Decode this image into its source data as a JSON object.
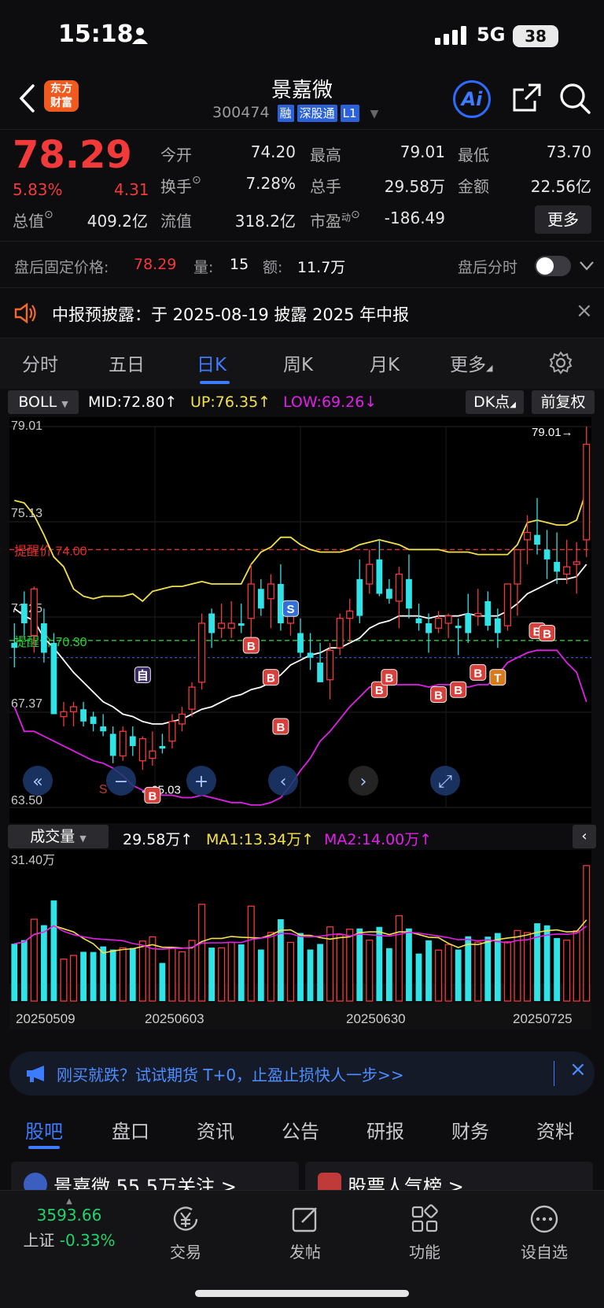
{
  "status": {
    "time": "15:18",
    "network": "5G",
    "battery": "38"
  },
  "header": {
    "logo_text": "东方\n财富",
    "title": "景嘉微",
    "code": "300474",
    "tags": [
      "融",
      "深股通",
      "L1"
    ],
    "ai_label": "Ai"
  },
  "quote": {
    "price": "78.29",
    "change_pct": "5.83%",
    "change": "4.31",
    "fields": [
      {
        "label": "今开",
        "value": "74.20",
        "color": "red"
      },
      {
        "label": "最高",
        "value": "79.01",
        "color": "red"
      },
      {
        "label": "最低",
        "value": "73.70",
        "color": "green"
      },
      {
        "label": "换手",
        "value": "7.28%",
        "color": "white"
      },
      {
        "label": "总手",
        "value": "29.58万",
        "color": "white"
      },
      {
        "label": "金额",
        "value": "22.56亿",
        "color": "white"
      },
      {
        "label": "总值",
        "value": "409.2亿",
        "color": "white"
      },
      {
        "label": "流值",
        "value": "318.2亿",
        "color": "white"
      },
      {
        "label": "市盈",
        "value": "-186.49",
        "color": "white"
      }
    ],
    "pe_superscript": "动",
    "more_label": "更多"
  },
  "afterhours": {
    "price_label": "盘后固定价格:",
    "price": "78.29",
    "vol_label": "量:",
    "vol": "15",
    "amt_label": "额:",
    "amt": "11.7万",
    "toggle_label": "盘后分时"
  },
  "notice": {
    "text": "中报预披露：于 2025-08-19 披露 2025 年中报"
  },
  "chart_tabs": [
    "分时",
    "五日",
    "日K",
    "周K",
    "月K",
    "更多"
  ],
  "indicator": {
    "name": "BOLL",
    "mid": "MID:72.80",
    "up": "UP:76.35",
    "low": "LOW:69.26",
    "dk_label": "DK点",
    "adj_label": "前复权"
  },
  "kchart_labels": {
    "axis": [
      "79.01",
      "75.13",
      "71.25",
      "67.37",
      "63.50"
    ],
    "alert_high": "提醒价 74.00",
    "alert_low": "提醒价 70.30",
    "max_label": "79.01→",
    "min_label": "←65.03",
    "marker_self": "自",
    "marker_s": "S",
    "marker_b": "B",
    "marker_t": "T"
  },
  "chart_data": {
    "type": "candlestick",
    "ylim": [
      63.5,
      79.01
    ],
    "candles": [
      [
        70.2,
        71.0,
        69.2,
        70.0
      ],
      [
        71.8,
        72.3,
        70.5,
        71.0
      ],
      [
        70.5,
        72.5,
        69.8,
        72.4
      ],
      [
        71.0,
        71.6,
        69.4,
        69.8
      ],
      [
        70.2,
        70.6,
        67.3,
        67.3
      ],
      [
        67.2,
        67.8,
        66.8,
        67.4
      ],
      [
        67.4,
        67.8,
        66.8,
        67.6
      ],
      [
        67.5,
        67.8,
        66.8,
        67.0
      ],
      [
        67.2,
        67.4,
        66.6,
        66.9
      ],
      [
        66.8,
        67.3,
        66.4,
        66.6
      ],
      [
        66.5,
        66.8,
        65.3,
        65.6
      ],
      [
        65.6,
        66.8,
        65.4,
        66.6
      ],
      [
        66.4,
        66.8,
        65.6,
        66.0
      ],
      [
        65.4,
        66.4,
        65.03,
        66.3
      ],
      [
        65.5,
        66.6,
        65.2,
        65.8
      ],
      [
        66.0,
        66.5,
        65.7,
        65.9
      ],
      [
        66.2,
        67.3,
        65.9,
        67.0
      ],
      [
        66.9,
        67.6,
        66.6,
        67.3
      ],
      [
        67.5,
        68.6,
        67.2,
        68.4
      ],
      [
        68.6,
        71.4,
        68.3,
        71.0
      ],
      [
        71.4,
        71.6,
        70.0,
        70.6
      ],
      [
        70.8,
        71.8,
        70.4,
        71.0
      ],
      [
        70.8,
        71.9,
        70.4,
        71.0
      ],
      [
        71.0,
        71.8,
        70.6,
        70.9
      ],
      [
        71.2,
        73.4,
        70.4,
        72.6
      ],
      [
        72.4,
        72.8,
        71.3,
        71.6
      ],
      [
        72.0,
        73.0,
        70.8,
        72.6
      ],
      [
        72.6,
        73.4,
        70.7,
        71.0
      ],
      [
        71.0,
        71.8,
        70.5,
        71.3
      ],
      [
        70.6,
        71.2,
        69.6,
        69.8
      ],
      [
        69.8,
        70.6,
        69.1,
        69.6
      ],
      [
        69.4,
        70.2,
        68.6,
        68.6
      ],
      [
        68.7,
        70.2,
        67.9,
        69.9
      ],
      [
        70.0,
        71.4,
        69.7,
        71.2
      ],
      [
        71.2,
        72.0,
        70.2,
        71.5
      ],
      [
        72.8,
        73.6,
        71.0,
        71.3
      ],
      [
        72.6,
        74.0,
        72.2,
        73.4
      ],
      [
        73.6,
        74.4,
        72.1,
        72.2
      ],
      [
        72.4,
        72.8,
        71.8,
        72.0
      ],
      [
        71.9,
        73.3,
        70.8,
        73.0
      ],
      [
        72.8,
        73.8,
        71.2,
        71.6
      ],
      [
        71.2,
        71.8,
        70.7,
        71.0
      ],
      [
        71.0,
        71.4,
        69.8,
        70.6
      ],
      [
        70.8,
        71.5,
        70.6,
        71.2
      ],
      [
        71.0,
        71.4,
        70.4,
        71.3
      ],
      [
        70.9,
        71.2,
        69.7,
        70.8
      ],
      [
        71.4,
        72.2,
        70.2,
        70.6
      ],
      [
        71.3,
        72.4,
        70.9,
        71.4
      ],
      [
        71.9,
        72.3,
        70.7,
        70.9
      ],
      [
        71.2,
        71.6,
        70.0,
        70.6
      ],
      [
        70.9,
        72.6,
        70.7,
        72.6
      ],
      [
        72.6,
        73.6,
        71.3,
        74.0
      ],
      [
        74.4,
        75.4,
        73.4,
        74.7
      ],
      [
        74.6,
        76.1,
        73.8,
        74.2
      ],
      [
        74.0,
        74.8,
        72.8,
        73.6
      ],
      [
        73.5,
        74.7,
        72.6,
        73.1
      ],
      [
        73.0,
        74.4,
        72.6,
        73.3
      ],
      [
        73.4,
        74.3,
        72.2,
        73.5
      ],
      [
        74.4,
        79.01,
        73.7,
        78.29
      ]
    ],
    "boll_up": [
      76.0,
      75.9,
      75.4,
      74.6,
      73.7,
      73.3,
      72.4,
      72.1,
      72.0,
      72.1,
      72.1,
      72.1,
      72.2,
      71.9,
      72.3,
      72.4,
      72.5,
      72.5,
      72.6,
      72.7,
      72.6,
      72.6,
      72.6,
      72.6,
      73.4,
      73.9,
      74.1,
      74.5,
      74.5,
      74.2,
      74.0,
      73.9,
      73.9,
      73.9,
      74.0,
      74.2,
      74.3,
      74.4,
      74.3,
      74.2,
      74.0,
      74.0,
      74.0,
      74.0,
      73.9,
      73.9,
      73.9,
      73.8,
      73.8,
      73.8,
      73.8,
      74.2,
      75.1,
      75.2,
      75.1,
      75.0,
      75.0,
      75.2,
      76.4
    ],
    "boll_mid": [
      71.6,
      71.3,
      71.1,
      70.4,
      70.0,
      69.5,
      69.0,
      68.6,
      68.2,
      67.8,
      67.6,
      67.3,
      67.2,
      67.0,
      66.9,
      66.9,
      67.0,
      67.1,
      67.3,
      67.5,
      67.6,
      67.8,
      68.0,
      68.1,
      68.3,
      68.4,
      68.6,
      68.9,
      69.3,
      69.5,
      69.7,
      69.8,
      70.0,
      70.0,
      70.2,
      70.4,
      70.8,
      71.0,
      71.1,
      71.3,
      71.3,
      71.3,
      71.2,
      71.3,
      71.3,
      71.3,
      71.4,
      71.3,
      71.3,
      71.3,
      71.5,
      71.8,
      72.2,
      72.4,
      72.6,
      72.8,
      72.8,
      72.9,
      73.4
    ],
    "boll_low": [
      67.6,
      66.6,
      66.6,
      66.4,
      66.2,
      66.0,
      65.8,
      65.6,
      65.4,
      65.3,
      65.1,
      64.8,
      64.4,
      64.2,
      64.1,
      64.0,
      64.0,
      63.9,
      63.9,
      64.0,
      63.9,
      63.8,
      63.7,
      63.7,
      63.6,
      63.6,
      63.7,
      63.9,
      64.4,
      65.0,
      65.5,
      66.2,
      66.6,
      67.1,
      67.6,
      68.0,
      68.4,
      68.5,
      68.5,
      68.5,
      68.5,
      68.5,
      68.4,
      68.5,
      68.5,
      68.5,
      68.4,
      68.5,
      68.5,
      68.9,
      69.4,
      69.6,
      69.8,
      69.9,
      69.9,
      69.9,
      69.4,
      69.0,
      67.8
    ],
    "volume": {
      "ylabel_max": "31.40万",
      "vol_label": "成交量",
      "vol": "29.58万",
      "ma1": "MA1:13.34万",
      "ma2": "MA2:14.00万",
      "dates": [
        "20250509",
        "20250603",
        "20250630",
        "20250725"
      ]
    }
  },
  "promo": {
    "text": "刚买就跌？试试期货 T+0，止盈止损快人一步>>"
  },
  "bottom_tabs": [
    "股吧",
    "盘口",
    "资讯",
    "公告",
    "研报",
    "财务",
    "资料"
  ],
  "cards": {
    "left": "景嘉微 55.5万关注 >",
    "right": "股票人气榜 >"
  },
  "tabbar": {
    "index_value": "3593.66",
    "index_name": "上证",
    "index_change": "-0.33%",
    "items": [
      "交易",
      "发帖",
      "功能",
      "设自选"
    ]
  },
  "colors": {
    "up": "#f23a3a",
    "down": "#2fe3e6",
    "boll_up": "#f3e14a",
    "boll_mid": "#ffffff",
    "boll_low": "#e020e8",
    "accent": "#3d7bff"
  }
}
